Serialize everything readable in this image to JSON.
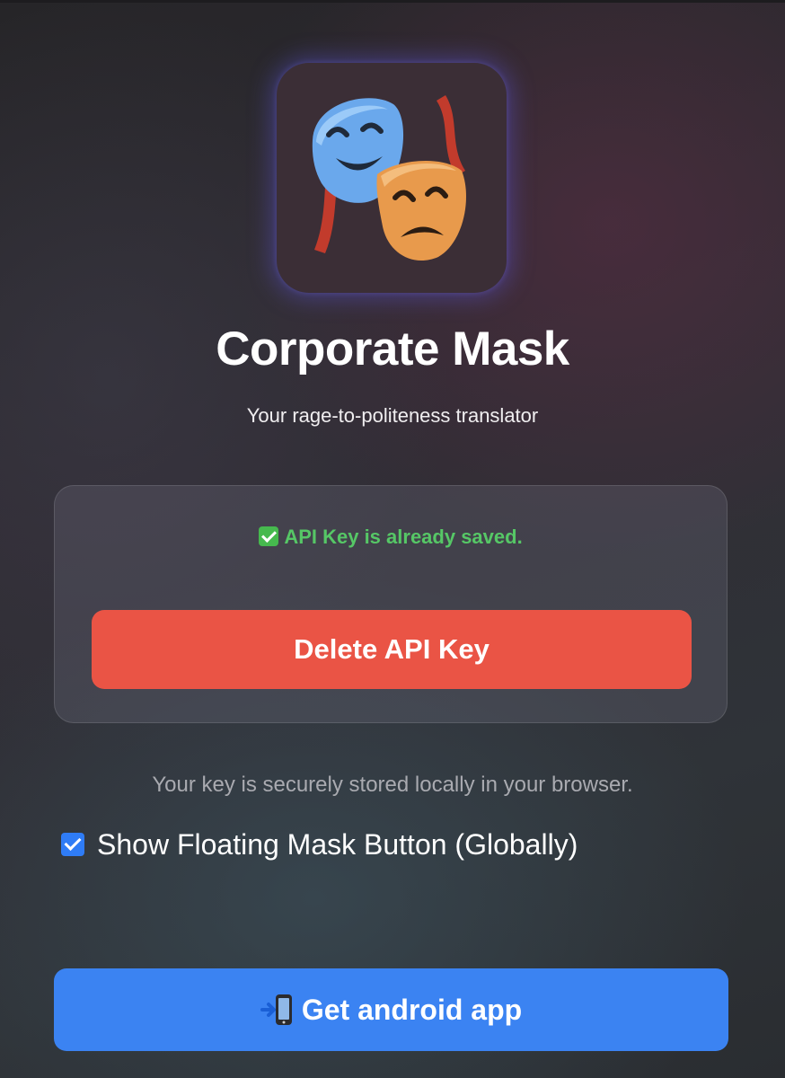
{
  "app": {
    "title": "Corporate Mask",
    "subtitle": "Your rage-to-politeness translator",
    "logo_icon": "theater-masks-icon"
  },
  "api_key_card": {
    "status_icon": "check-mark-icon",
    "status_text": "API Key is already saved.",
    "delete_button_label": "Delete API Key"
  },
  "storage_note": "Your key is securely stored locally in your browser.",
  "floating_toggle": {
    "label": "Show Floating Mask Button (Globally)",
    "checked": true
  },
  "android_button": {
    "icon": "mobile-phone-arrow-icon",
    "label": "Get android app"
  },
  "colors": {
    "status_green": "#56c766",
    "delete_red": "#ea5445",
    "primary_blue": "#3b83f2",
    "checkbox_blue": "#2f7cf6"
  }
}
